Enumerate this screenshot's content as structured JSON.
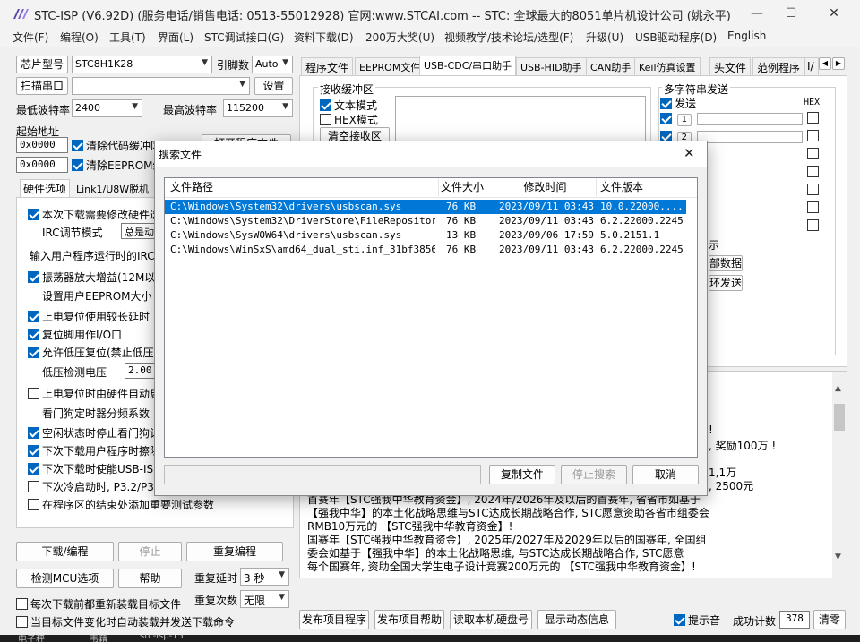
{
  "window": {
    "title": "STC-ISP (V6.92D) (服务电话/销售电话: 0513-55012928) 官网:www.STCAI.com  -- STC: 全球最大的8051单片机设计公司 (姚永平)",
    "minimize": "—",
    "maximize": "☐",
    "close": "✕"
  },
  "menu": [
    "文件(F)",
    "编程(O)",
    "工具(T)",
    "界面(L)",
    "STC调试接口(G)",
    "资料下载(D)",
    "200万大奖(U)",
    "视频教学/技术论坛/选型(F)",
    "升级(U)",
    "USB驱动程序(D)",
    "English"
  ],
  "left": {
    "chip_label": "芯片型号",
    "chip_value": "STC8H1K28",
    "pin_label": "引脚数",
    "pin_value": "Auto",
    "scan_label": "扫描串口",
    "port_value": "",
    "settings_label": "设置",
    "min_baud_label": "最低波特率",
    "min_baud": "2400",
    "max_baud_label": "最高波特率",
    "max_baud": "115200",
    "start_addr_label": "起始地址",
    "addr1": "0x0000",
    "addr2": "0x0000",
    "clear_code": "清除代码缓冲区",
    "clear_eeprom": "清除EEPROM缓冲",
    "open_program": "打开程序文件",
    "tabs": [
      "硬件选项",
      "Link1/U8W脱机"
    ],
    "options": [
      {
        "text": "本次下载需要修改硬件选",
        "checked": true
      },
      {
        "text": "IRC调节模式",
        "checked": null
      },
      {
        "text": "输入用户程序运行时的IRC",
        "checked": null
      },
      {
        "text": "振荡器放大增益(12M以上",
        "checked": true
      },
      {
        "text": "设置用户EEPROM大小",
        "checked": null
      },
      {
        "text": "上电复位使用较长延时",
        "checked": true
      },
      {
        "text": "复位脚用作I/O口",
        "checked": true
      },
      {
        "text": "允许低压复位(禁止低压",
        "checked": true
      },
      {
        "text": "低压检测电压",
        "checked": null
      },
      {
        "text": "上电复位时由硬件自动启",
        "checked": false
      },
      {
        "text": "看门狗定时器分频系数",
        "checked": null
      },
      {
        "text": "空闲状态时停止看门狗计",
        "checked": true
      },
      {
        "text": "下次下载用户程序时擦除",
        "checked": true
      },
      {
        "text": "下次下载时使能USB-ISP",
        "checked": true
      },
      {
        "text": "下次冷启动时, P3.2/P3.",
        "checked": false
      },
      {
        "text": "在程序区的结束处添加重要测试参数",
        "checked": false
      }
    ],
    "irc_mode_value": "总是动态",
    "lvd_value": "2.00",
    "download_btn": "下载/编程",
    "stop_btn": "停止",
    "reprogram_btn": "重复编程",
    "detect_btn": "检测MCU选项",
    "help_btn": "帮助",
    "repeat_delay_label": "重复延时",
    "repeat_delay_value": "3 秒",
    "repeat_count_label": "重复次数",
    "repeat_count_value": "无限",
    "reload_each": "每次下载前都重新装载目标文件",
    "auto_reload": "当目标文件变化时自动装载并发送下载命令"
  },
  "right": {
    "tabs": [
      "程序文件",
      "EEPROM文件",
      "USB-CDC/串口助手",
      "USB-HID助手",
      "CAN助手",
      "Keil仿真设置",
      "头文件",
      "范例程序",
      "I/"
    ],
    "recv_group": "接收缓冲区",
    "text_mode": "文本模式",
    "hex_mode": "HEX模式",
    "clear_recv": "清空接收区",
    "multi_send": "多字符串发送",
    "send_col": "发送",
    "hex_col": "HEX",
    "row1": "1",
    "row2": "2",
    "partial_tip": "示",
    "partial_btn1": "部数据",
    "partial_btn2": "环发送",
    "log": [
      "!",
      ", 奖励100万 !",
      "1,1万",
      ", 2500元",
      "首赛年【STC强我中华教育资金】, 2024年/2026年及以后的首赛年, 省省市如基于",
      "【强我中华】的本土化战略思维与STC达成长期战略合作, STC愿意资助各省市组委会",
      "RMB10万元的 【STC强我中华教育资金】!",
      "国赛年【STC强我中华教育资金】, 2025年/2027年及2029年以后的国赛年, 全国组",
      "委会如基于【强我中华】的本土化战略思维, 与STC达成长期战略合作, STC愿意",
      "每个国赛年, 资助全国大学生电子设计竞赛200万元的 【STC强我中华教育资金】!"
    ],
    "publish_prog": "发布项目程序",
    "publish_help": "发布项目帮助",
    "read_disk": "读取本机硬盘号",
    "show_dynamic": "显示动态信息",
    "sound_tip": "提示音",
    "success_label": "成功计数",
    "success_count": "378",
    "clear_count": "清零"
  },
  "dialog": {
    "title": "搜索文件",
    "close": "✕",
    "columns": [
      "文件路径",
      "文件大小",
      "修改时间",
      "文件版本"
    ],
    "rows": [
      {
        "path": "C:\\Windows\\System32\\drivers\\usbscan.sys",
        "size": "76 KB",
        "time": "2023/09/11  03:43",
        "version": "10.0.22000...."
      },
      {
        "path": "C:\\Windows\\System32\\DriverStore\\FileRepositor...",
        "size": "76 KB",
        "time": "2023/09/11  03:43",
        "version": "6.2.22000.2245"
      },
      {
        "path": "C:\\Windows\\SysWOW64\\drivers\\usbscan.sys",
        "size": "13 KB",
        "time": "2023/09/06  17:59",
        "version": "5.0.2151.1"
      },
      {
        "path": "C:\\Windows\\WinSxS\\amd64_dual_sti.inf_31bf3856...",
        "size": "76 KB",
        "time": "2023/09/11  03:43",
        "version": "6.2.22000.2245"
      }
    ],
    "status_text": "",
    "copy_btn": "复制文件",
    "stop_btn": "停止搜索",
    "cancel_btn": "取消"
  },
  "taskbar": [
    "电子秤",
    "韦藉",
    "stc-isp-15"
  ]
}
